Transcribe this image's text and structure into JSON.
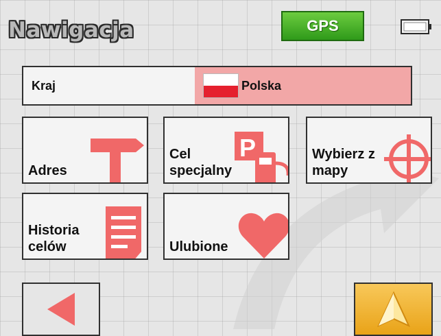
{
  "header": {
    "title": "Nawigacja",
    "gps_label": "GPS",
    "battery_icon": "battery-icon"
  },
  "country": {
    "label": "Kraj",
    "value": "Polska",
    "flag_icon": "poland-flag-icon"
  },
  "tiles": [
    {
      "label": "Adres",
      "icon": "signpost-icon"
    },
    {
      "label": "Cel\nspecjalny",
      "icon": "parking-fuel-icon"
    },
    {
      "label": "Wybierz z\nmapy",
      "icon": "crosshair-icon"
    },
    {
      "label": "Historia\ncelów",
      "icon": "document-list-icon"
    },
    {
      "label": "Ulubione",
      "icon": "heart-icon"
    }
  ],
  "bottom": {
    "back_icon": "back-arrow-icon",
    "navigate_icon": "navigation-arrow-icon"
  },
  "colors": {
    "accent_red": "#f06868",
    "gps_green": "#3fb020",
    "nav_orange": "#f0b030",
    "tile_background": "#f4f4f4",
    "country_highlight": "#f2a7a7"
  }
}
